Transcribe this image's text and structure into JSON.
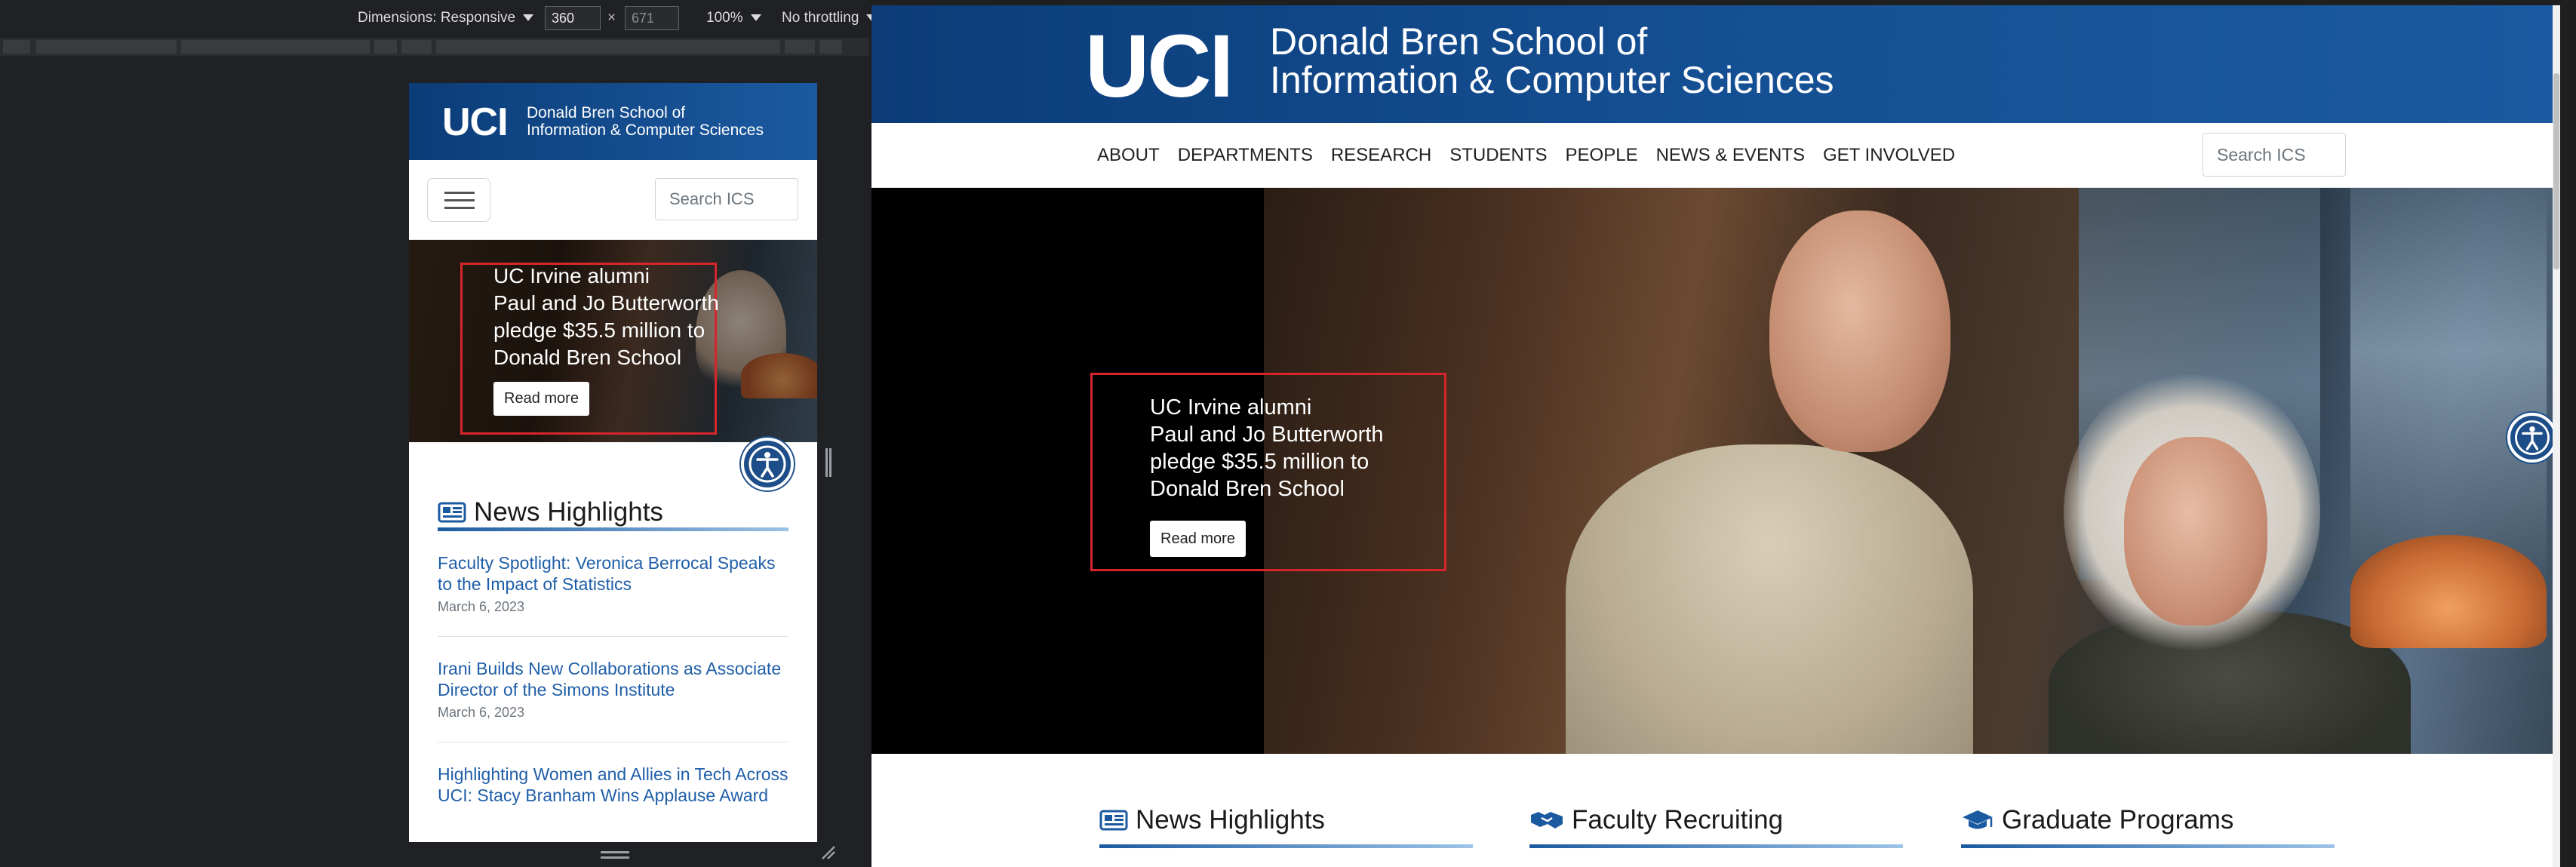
{
  "devtools": {
    "dimensions_label": "Dimensions: Responsive",
    "width_value": "360",
    "height_placeholder": "671",
    "times_sign": "×",
    "zoom_label": "100%",
    "throttle_label": "No throttling"
  },
  "site": {
    "logo": "UCI",
    "school_line1": "Donald Bren School of",
    "school_line2": "Information & Computer Sciences",
    "search_placeholder": "Search ICS",
    "nav": [
      "ABOUT",
      "DEPARTMENTS",
      "RESEARCH",
      "STUDENTS",
      "PEOPLE",
      "NEWS & EVENTS",
      "GET INVOLVED"
    ],
    "hero": {
      "line1": "UC Irvine alumni",
      "line2": "Paul and Jo Butterworth",
      "line3": "pledge $35.5 million to",
      "line4": "Donald Bren School",
      "button": "Read more"
    },
    "news_title": "News Highlights",
    "news": [
      {
        "title": "Faculty Spotlight: Veronica Berrocal Speaks to the Impact of Statistics",
        "date": "March 6, 2023"
      },
      {
        "title": "Irani Builds New Collaborations as Associate Director of the Simons Institute",
        "date": "March 6, 2023"
      },
      {
        "title": "Highlighting Women and Allies in Tech Across UCI: Stacy Branham Wins Applause Award",
        "date": ""
      }
    ],
    "sections": [
      "News Highlights",
      "Faculty Recruiting",
      "Graduate Programs"
    ]
  },
  "colors": {
    "brand_blue": "#1b5aa0",
    "link_blue": "#1f5ea8",
    "highlight_red": "#d7262b"
  }
}
